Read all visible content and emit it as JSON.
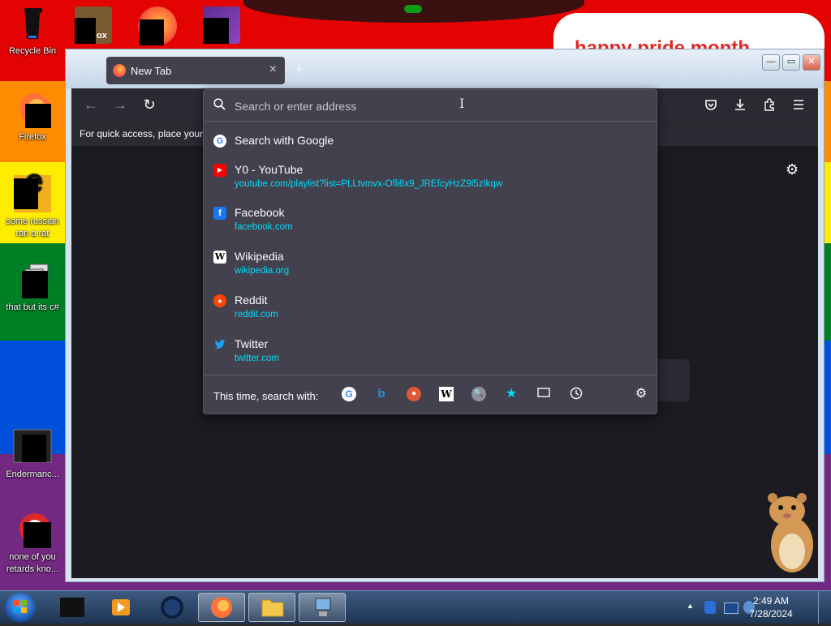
{
  "desktop": {
    "banner_text": "happy pride month",
    "icons": [
      {
        "label": "Recycle Bin"
      },
      {
        "label": "Firefox"
      },
      {
        "label": "some russian ran a rat"
      },
      {
        "label": "that but its c#"
      },
      {
        "label": "Endermanc..."
      },
      {
        "label": "none of you retards kno..."
      }
    ],
    "top_icon_partial_text": "ox"
  },
  "browser": {
    "tab": {
      "title": "New Tab",
      "close": "×"
    },
    "new_tab_symbol": "+",
    "caption": {
      "minimize": "—",
      "maximize": "▭",
      "close": "✕"
    },
    "nav": {
      "back": "←",
      "forward": "→",
      "reload": "↻"
    },
    "bookmarks_hint": "For quick access, place your b",
    "urlbar": {
      "placeholder": "Search or enter address"
    },
    "results": [
      {
        "title": "Search with Google",
        "url": "",
        "icon": "google-icon"
      },
      {
        "title": "Y0 - YouTube",
        "url": "youtube.com/playlist?list=PLLtvmvx-Ofli6x9_JREfcyHzZ9l5zIkqw",
        "icon": "youtube-icon"
      },
      {
        "title": "Facebook",
        "url": "facebook.com",
        "icon": "facebook-icon"
      },
      {
        "title": "Wikipedia",
        "url": "wikipedia.org",
        "icon": "wikipedia-icon"
      },
      {
        "title": "Reddit",
        "url": "reddit.com",
        "icon": "reddit-icon"
      },
      {
        "title": "Twitter",
        "url": "twitter.com",
        "icon": "twitter-icon"
      }
    ],
    "one_off": {
      "label": "This time, search with:",
      "engines": [
        "google-icon",
        "bing-icon",
        "duckduckgo-icon",
        "wikipedia-icon",
        "search-engine-icon",
        "bookmarks-star-icon",
        "tabs-icon",
        "history-icon"
      ]
    },
    "colors": {
      "accent_link": "#00ddff",
      "panel_bg": "#42414d",
      "content_bg": "#1c1b22"
    }
  },
  "taskbar": {
    "clock": {
      "time": "2:49 AM",
      "date": "7/28/2024"
    },
    "tray_arrow": "▲"
  }
}
